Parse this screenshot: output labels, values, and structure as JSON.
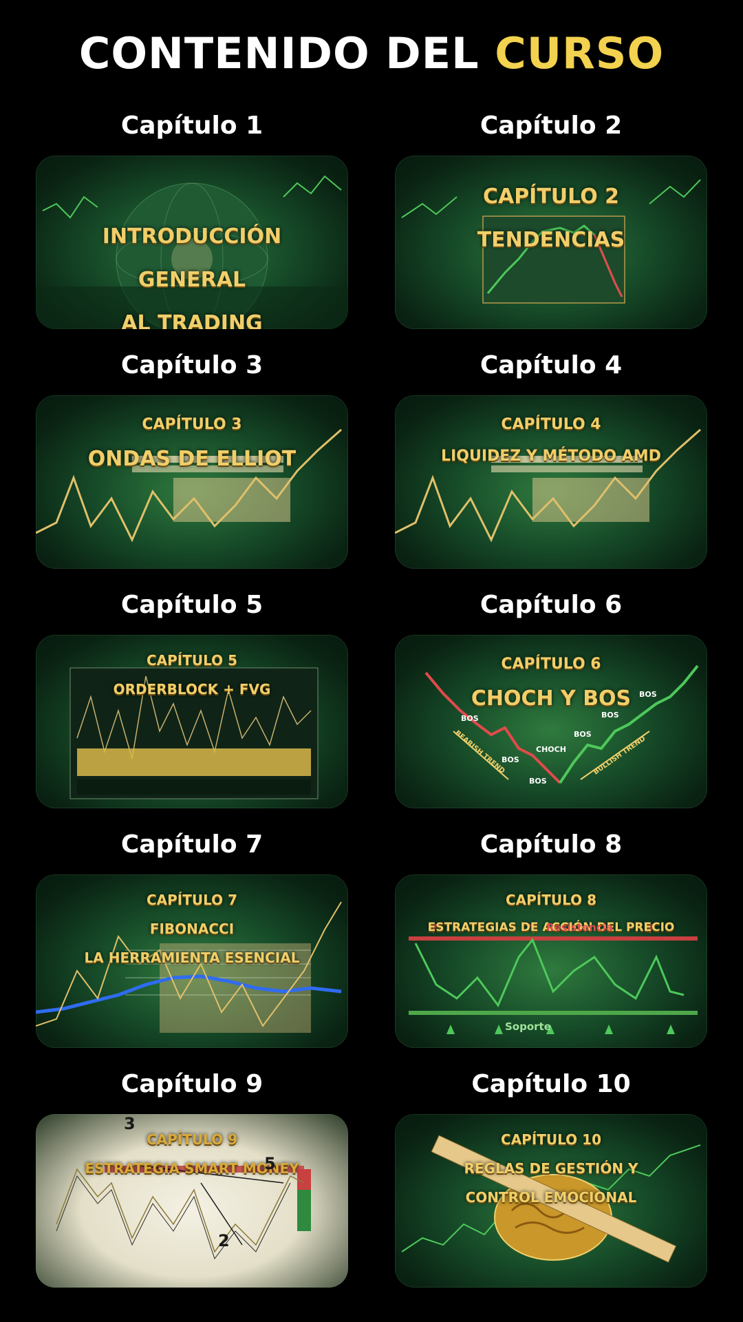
{
  "header": {
    "title_main": "CONTENIDO DEL",
    "title_accent": "CURSO"
  },
  "colors": {
    "accent": "#f2d24e",
    "background": "#000000",
    "card_green": "#164a28",
    "card_text_gold": "#f0cf6a"
  },
  "chapters": [
    {
      "label": "Capítulo 1",
      "card_lines": [
        "INTRODUCCIÓN",
        "GENERAL",
        "AL TRADING"
      ]
    },
    {
      "label": "Capítulo 2",
      "card_lines": [
        "CAPÍTULO 2",
        "TENDENCIAS"
      ]
    },
    {
      "label": "Capítulo 3",
      "card_lines": [
        "CAPÍTULO 3",
        "ONDAS DE ELLIOT"
      ]
    },
    {
      "label": "Capítulo 4",
      "card_lines": [
        "CAPÍTULO 4",
        "LIQUIDEZ Y MÉTODO AMD"
      ]
    },
    {
      "label": "Capítulo 5",
      "card_lines": [
        "CAPÍTULO 5",
        "ORDERBLOCK + FVG"
      ]
    },
    {
      "label": "Capítulo 6",
      "card_lines": [
        "CAPÍTULO 6",
        "CHOCH Y BOS"
      ],
      "marks": [
        "BOS",
        "BOS",
        "BOS",
        "CHOCH",
        "BOS",
        "BOS",
        "BOS"
      ],
      "trend_labels": [
        "BEARISH TREND",
        "BULLISH TREND"
      ]
    },
    {
      "label": "Capítulo 7",
      "card_lines": [
        "CAPÍTULO 7",
        "FIBONACCI",
        "LA HERRAMIENTA ESENCIAL"
      ]
    },
    {
      "label": "Capítulo 8",
      "card_lines": [
        "CAPÍTULO 8",
        "ESTRATEGIAS DE ACCIÓN DEL PRECIO"
      ],
      "resistance_label": "Resistencia",
      "support_label": "Soporte"
    },
    {
      "label": "Capítulo 9",
      "card_lines": [
        "CAPÍTULO 9",
        "ESTRATEGIA SMART MONEY"
      ],
      "wave_marks": [
        "3",
        "5",
        "2"
      ]
    },
    {
      "label": "Capítulo 10",
      "card_lines": [
        "CAPÍTULO 10",
        "REGLAS DE GESTIÓN Y",
        "CONTROL EMOCIONAL"
      ]
    }
  ]
}
